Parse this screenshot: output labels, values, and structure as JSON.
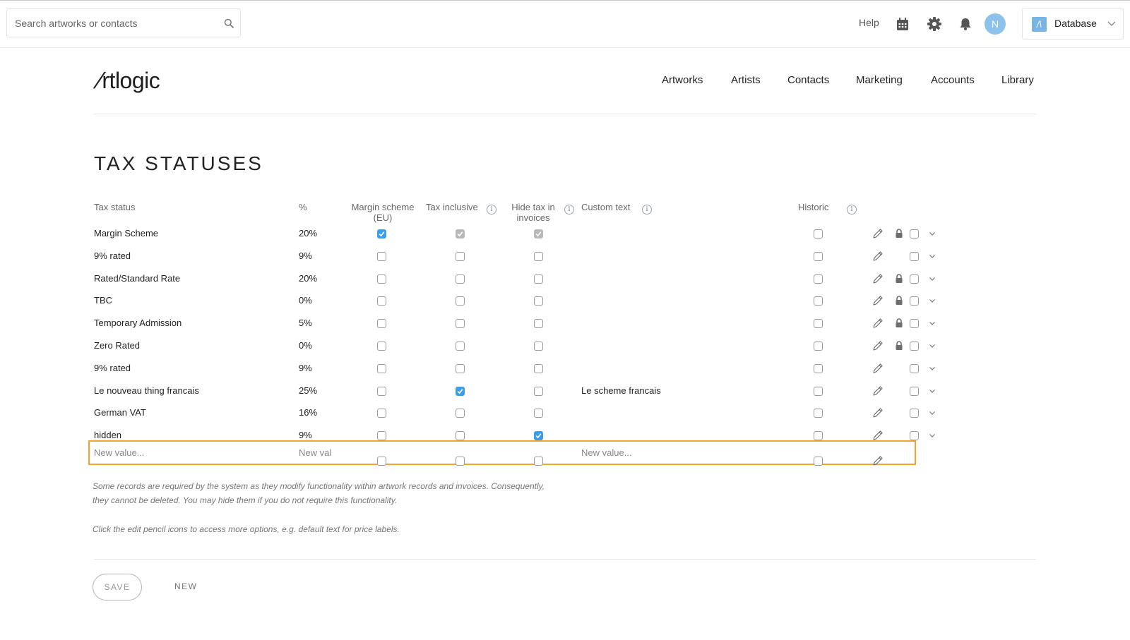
{
  "topbar": {
    "search_placeholder": "Search artworks or contacts",
    "help": "Help",
    "avatar_initial": "N",
    "database_label": "Database",
    "database_logo": "/\\",
    "accent": "#8dc2ea"
  },
  "brand": {
    "logo_text": "rtlogic"
  },
  "nav": [
    "Artworks",
    "Artists",
    "Contacts",
    "Marketing",
    "Accounts",
    "Library"
  ],
  "page": {
    "title": "TAX STATUSES"
  },
  "columns": {
    "tax_status": "Tax status",
    "percent": "%",
    "margin_scheme": [
      "Margin scheme",
      "(EU)"
    ],
    "tax_inclusive": "Tax inclusive",
    "hide_tax": [
      "Hide tax in",
      "invoices"
    ],
    "custom_text": "Custom text",
    "historic": "Historic",
    "info_glyph": "i"
  },
  "rows": [
    {
      "name": "Margin Scheme",
      "pct": "20%",
      "margin": "checked",
      "inclusive": "checked-disabled",
      "hide": "checked-disabled",
      "custom": "",
      "locked": true
    },
    {
      "name": "9% rated",
      "pct": "9%",
      "margin": "off",
      "inclusive": "off",
      "hide": "off",
      "custom": "",
      "locked": false
    },
    {
      "name": "Rated/Standard Rate",
      "pct": "20%",
      "margin": "off",
      "inclusive": "off",
      "hide": "off",
      "custom": "",
      "locked": true
    },
    {
      "name": "TBC",
      "pct": "0%",
      "margin": "off",
      "inclusive": "off",
      "hide": "off",
      "custom": "",
      "locked": true
    },
    {
      "name": "Temporary Admission",
      "pct": "5%",
      "margin": "off",
      "inclusive": "off",
      "hide": "off",
      "custom": "",
      "locked": true
    },
    {
      "name": "Zero Rated",
      "pct": "0%",
      "margin": "off",
      "inclusive": "off",
      "hide": "off",
      "custom": "",
      "locked": true
    },
    {
      "name": "9% rated",
      "pct": "9%",
      "margin": "off",
      "inclusive": "off",
      "hide": "off",
      "custom": "",
      "locked": false
    },
    {
      "name": "Le nouveau thing francais",
      "pct": "25%",
      "margin": "off",
      "inclusive": "checked",
      "hide": "off",
      "custom": "Le scheme francais",
      "locked": false
    },
    {
      "name": "German VAT",
      "pct": "16%",
      "margin": "off",
      "inclusive": "off",
      "hide": "off",
      "custom": "",
      "locked": false
    },
    {
      "name": "hidden",
      "pct": "9%",
      "margin": "off",
      "inclusive": "off",
      "hide": "checked",
      "custom": "",
      "locked": false
    }
  ],
  "new_row": {
    "name_placeholder": "New value...",
    "pct_placeholder": "New val",
    "custom_placeholder": "New value...",
    "highlight_color": "#f5a230"
  },
  "notes": {
    "line1": "Some records are required by the system as they modify functionality within artwork records and invoices. Consequently,",
    "line2": "they cannot be deleted. You may hide them if you do not require this functionality.",
    "line3": "Click the edit pencil icons to access more options, e.g. default text for price labels."
  },
  "actions": {
    "save": "SAVE",
    "new": "NEW"
  },
  "colors": {
    "checkbox_on": "#3c9ee9",
    "checkbox_disabled": "#b8b8b8"
  },
  "icons": [
    "search-icon",
    "calendar-icon",
    "gear-icon",
    "bell-icon",
    "chevron-down-icon",
    "info-icon",
    "pencil-icon",
    "lock-icon"
  ]
}
